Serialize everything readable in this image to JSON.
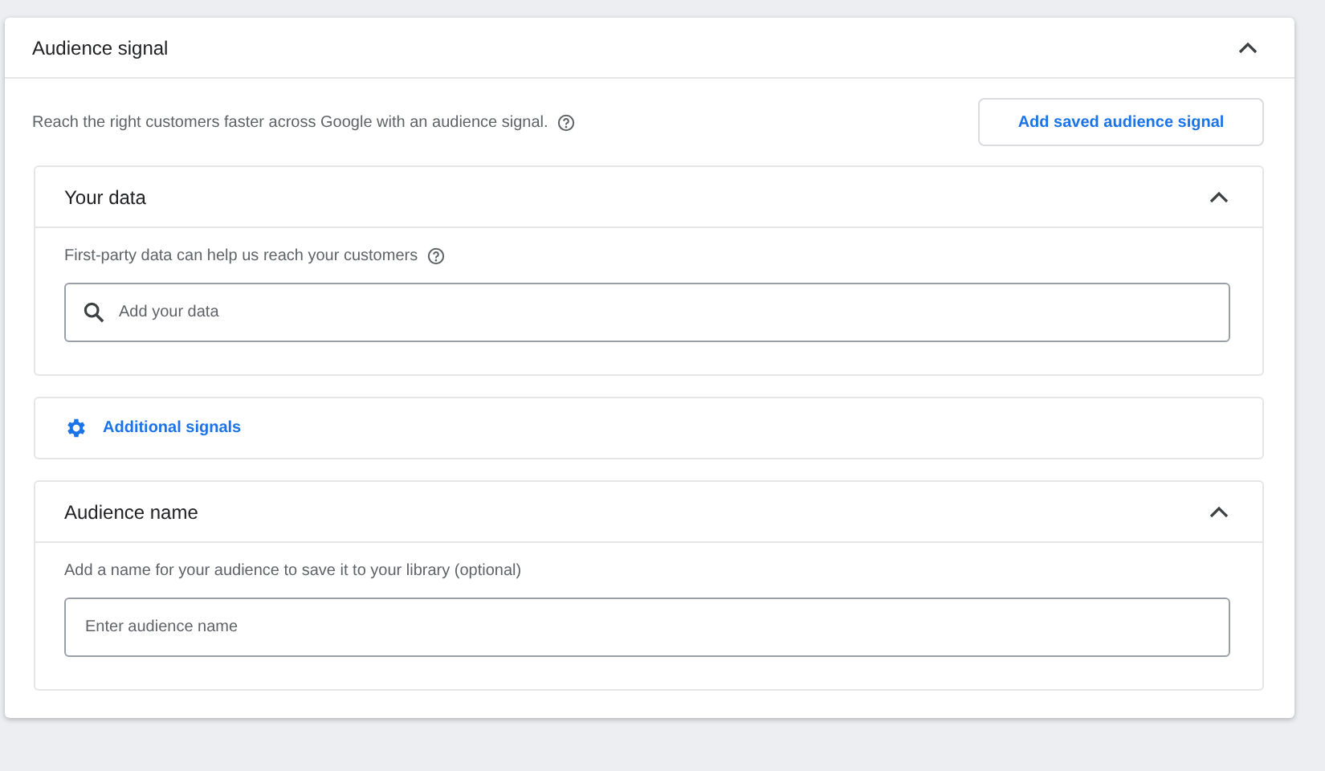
{
  "card": {
    "title": "Audience signal",
    "expanded": true,
    "description": "Reach the right customers faster across Google with an audience signal.",
    "action_button": "Add saved audience signal",
    "sections": [
      {
        "kind": "panel",
        "title": "Your data",
        "expanded": true,
        "hint": "First-party data can help us reach your customers",
        "hint_help": true,
        "field": {
          "placeholder": "Add your data",
          "search": true
        }
      },
      {
        "kind": "link",
        "title": "Additional signals"
      },
      {
        "kind": "panel",
        "title": "Audience name",
        "expanded": true,
        "hint": "Add a name for your audience to save it to your library (optional)",
        "hint_help": false,
        "field": {
          "placeholder": "Enter audience name",
          "search": false
        }
      }
    ]
  }
}
